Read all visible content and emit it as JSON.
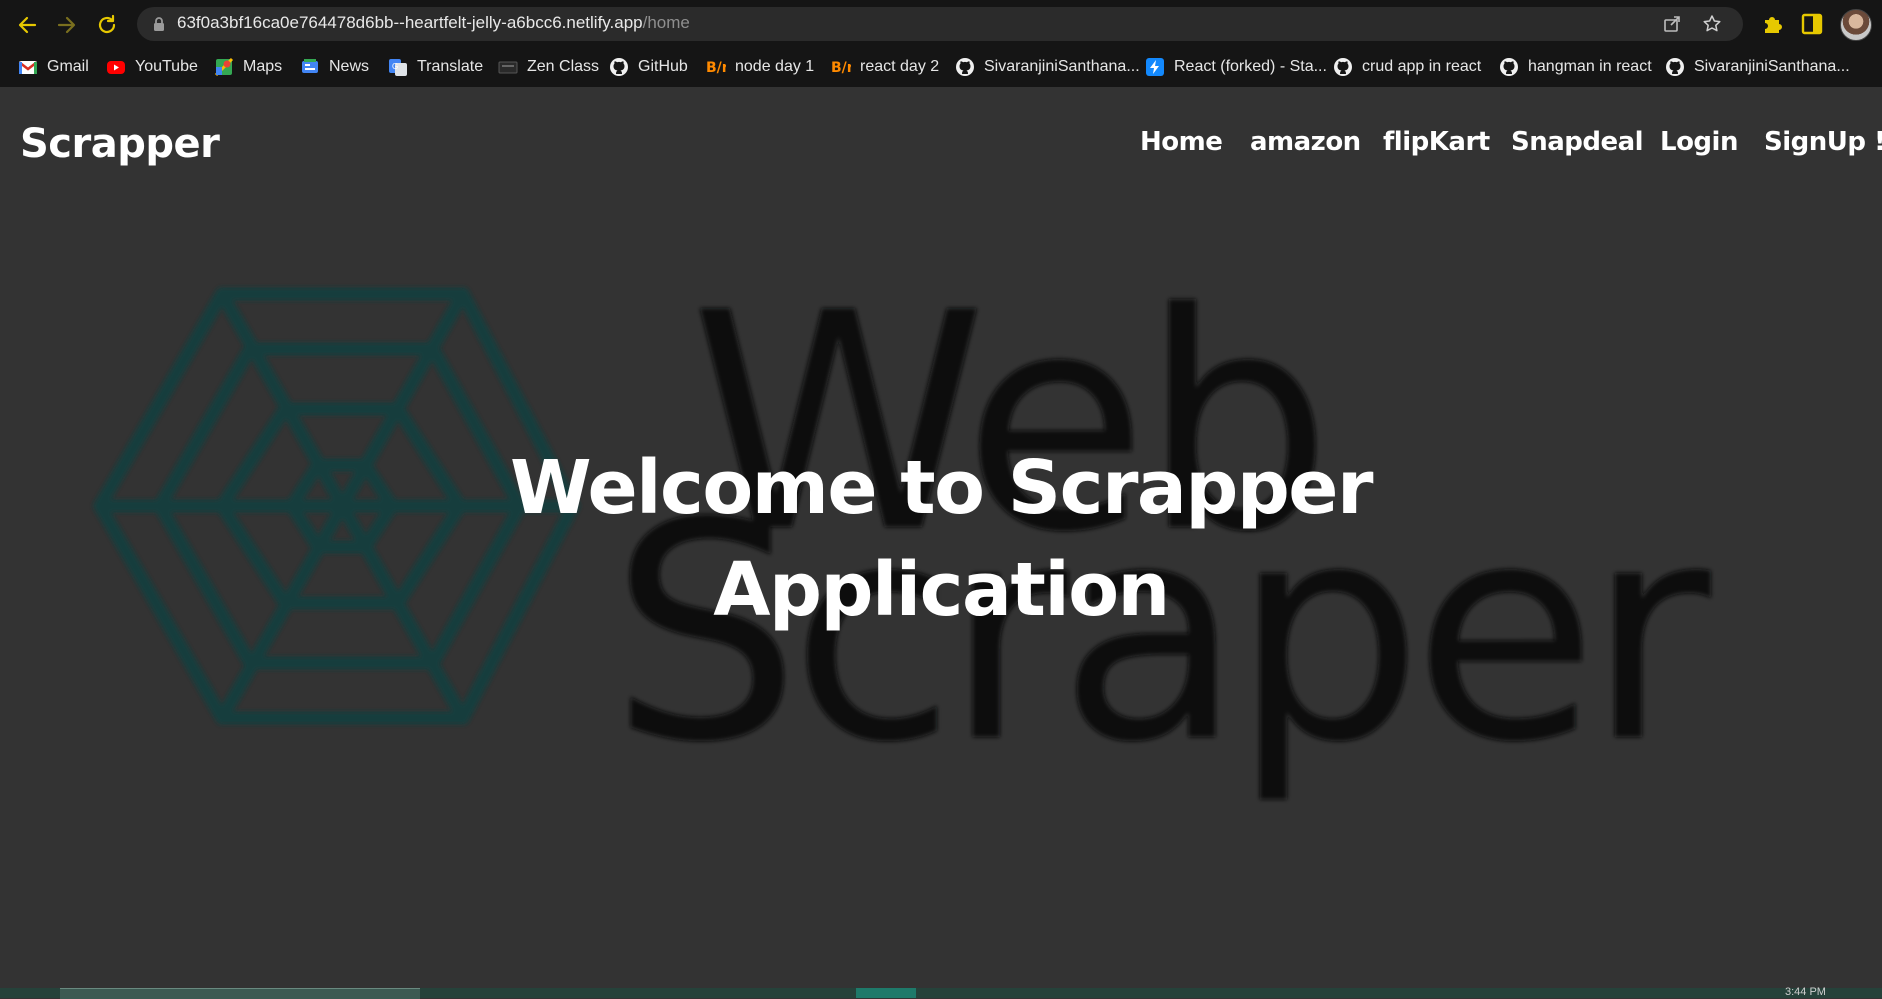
{
  "browser": {
    "url_host": "63f0a3bf16ca0e764478d6bb--heartfelt-jelly-a6bcc6.netlify.app",
    "url_path": "/home",
    "bookmarks": [
      {
        "label": "Gmail",
        "icon": "gmail-icon"
      },
      {
        "label": "YouTube",
        "icon": "youtube-icon"
      },
      {
        "label": "Maps",
        "icon": "maps-icon"
      },
      {
        "label": "News",
        "icon": "news-icon"
      },
      {
        "label": "Translate",
        "icon": "translate-icon"
      },
      {
        "label": "Zen Class",
        "icon": "zen-class-icon"
      },
      {
        "label": "GitHub",
        "icon": "github-icon"
      },
      {
        "label": "node day 1",
        "icon": "bn-icon"
      },
      {
        "label": "react day 2",
        "icon": "bn-icon"
      },
      {
        "label": "SivaranjiniSanthana...",
        "icon": "github-icon"
      },
      {
        "label": "React (forked) - Sta...",
        "icon": "stackblitz-icon"
      },
      {
        "label": "crud app in react",
        "icon": "github-icon"
      },
      {
        "label": "hangman in react",
        "icon": "github-icon"
      },
      {
        "label": "SivaranjiniSanthana...",
        "icon": "github-icon"
      }
    ]
  },
  "site": {
    "brand": "Scrapper",
    "nav": [
      "Home",
      "amazon",
      "flipKart",
      "Snapdeal",
      "Login",
      "SignUp !"
    ],
    "hero_line1": "Welcome to Scrapper",
    "hero_line2": "Application",
    "background_logo": {
      "word1": "Web",
      "word2": "Scraper"
    }
  },
  "taskbar": {
    "clock": "3:44 PM"
  },
  "colors": {
    "page_bg": "#333333",
    "chrome_bg": "#151515",
    "omnibox_bg": "#2b2b2b",
    "nav_icon_yellow": "#e6c800",
    "logo_teal": "#123c3c",
    "logo_text": "#0c0e10"
  }
}
